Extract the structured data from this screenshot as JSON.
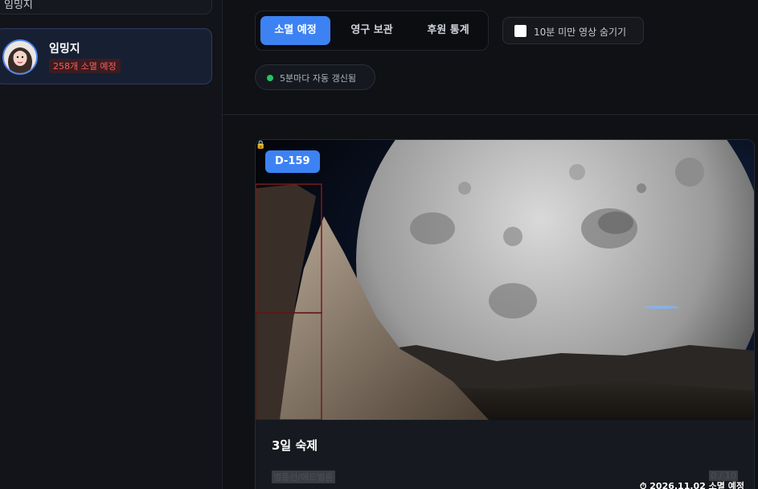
{
  "sidebar": {
    "prev_item_label": "임밍지",
    "active_item": {
      "name": "임밍지",
      "badge": "258개 소멸 예정"
    }
  },
  "tabs": [
    {
      "label": "소멸 예정",
      "active": true
    },
    {
      "label": "영구 보관",
      "active": false
    },
    {
      "label": "후원 통계",
      "active": false
    }
  ],
  "filter_toggle": {
    "label": "10분 미만 영상 숨기기",
    "checked": false
  },
  "status": {
    "text": "5분마다 자동 갱신됨",
    "color": "#22c55e"
  },
  "card": {
    "dday": "D-159",
    "expire_icon": "clock-icon",
    "expire_text": "2026.11.02 소멸 예정",
    "title": "3일 숙제",
    "input_placeholder": "별풍선/애드벌룬",
    "count": "0 / 10"
  },
  "colors": {
    "accent": "#3d82f3",
    "danger": "#ff5a5a",
    "success": "#22c55e"
  }
}
